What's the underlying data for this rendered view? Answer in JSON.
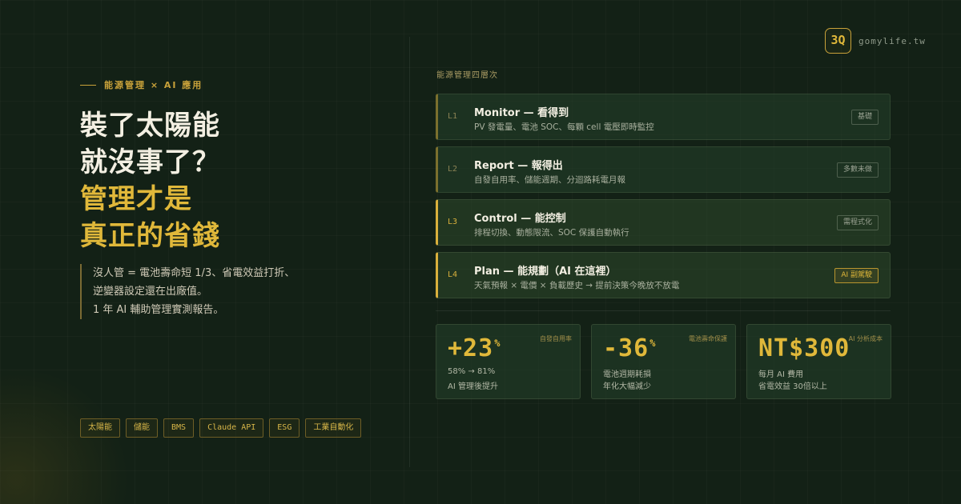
{
  "eyebrow": "能源管理 × AI 應用",
  "headline": {
    "line1": "裝了太陽能",
    "line2": "就沒事了？",
    "line3": "管理才是",
    "line4": "真正的省錢"
  },
  "lead": {
    "line1": "沒人管 = 電池壽命短 1/3、省電效益打折、",
    "line2": "逆變器設定還在出廠值。",
    "line3": "1 年 AI 輔助管理實測報告。"
  },
  "tags": [
    "太陽能",
    "儲能",
    "BMS",
    "Claude API",
    "ESG",
    "工業自動化"
  ],
  "brand": {
    "logo": "3Q",
    "url": "gomylife.tw"
  },
  "section_label": "能源管理四層次",
  "layers": [
    {
      "num": "L1",
      "title": "Monitor — 看得到",
      "sub": "PV 發電量、電池 SOC、每顆 cell 電壓即時監控",
      "badge": "基礎"
    },
    {
      "num": "L2",
      "title": "Report — 報得出",
      "sub": "自發自用率、儲能週期、分迴路耗電月報",
      "badge": "多數未做"
    },
    {
      "num": "L3",
      "title": "Control — 能控制",
      "sub": "排程切換、動態限流、SOC 保護自動執行",
      "badge": "需程式化"
    },
    {
      "num": "L4",
      "title": "Plan — 能規劃（AI 在這裡）",
      "sub": "天氣預報 × 電價 × 負載歷史 → 提前決策今晚放不放電",
      "badge": "AI 副駕駛"
    }
  ],
  "stats": [
    {
      "caption": "自發自用率",
      "value": "+23",
      "unit": "%",
      "line1": "58% → 81%",
      "line2": "AI 管理後提升"
    },
    {
      "caption": "電池壽命保護",
      "value": "-36",
      "unit": "%",
      "line1": "電池週期耗損",
      "line2": "年化大幅減少"
    },
    {
      "caption": "AI 分析成本",
      "value": "NT$300",
      "unit": "",
      "line1": "每月 AI 費用",
      "line2": "省電效益 30倍以上"
    }
  ],
  "colors": {
    "background": "#132116",
    "accent": "#e0b83a",
    "text": "#f3efe2"
  }
}
